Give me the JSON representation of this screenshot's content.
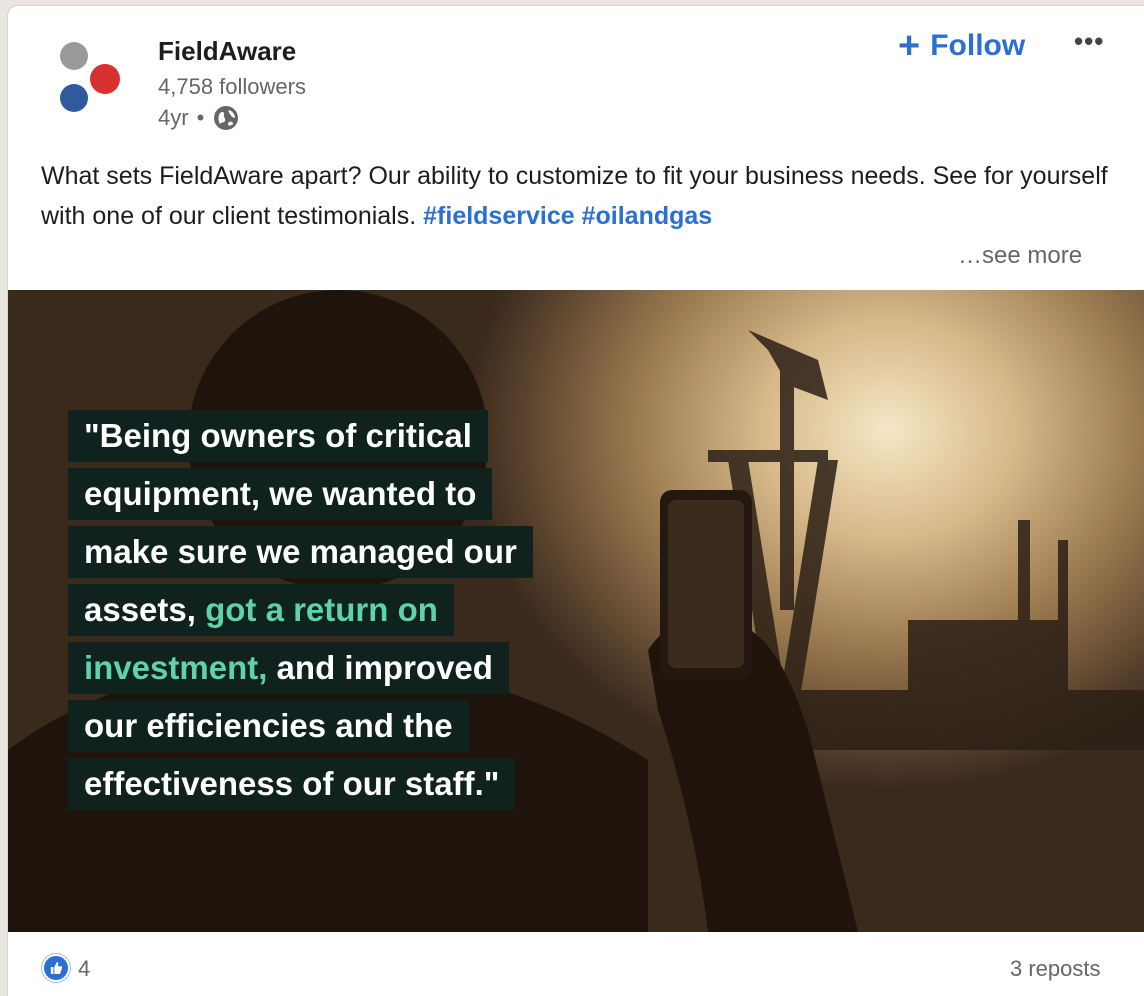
{
  "post": {
    "company": "FieldAware",
    "followers": "4,758 followers",
    "age": "4yr",
    "separator": "•",
    "follow_plus": "+",
    "follow_label": "Follow",
    "more_label": "•••",
    "text_main": "What sets FieldAware apart? Our ability to customize to fit your business needs. See for yourself with one of our client testimonials.",
    "hashtags": [
      "#fieldservice",
      "#oilandgas"
    ],
    "see_more": "…see more"
  },
  "media": {
    "quote_lines": [
      {
        "parts": [
          "\"Being owners of critical",
          "",
          ""
        ]
      },
      {
        "parts": [
          "equipment, we wanted to",
          "",
          ""
        ]
      },
      {
        "parts": [
          "make sure we managed our",
          "",
          ""
        ]
      },
      {
        "parts": [
          "assets, ",
          "got a return on",
          ""
        ]
      },
      {
        "parts": [
          "",
          "investment,",
          " and improved"
        ]
      },
      {
        "parts": [
          "our efficiencies and the",
          "",
          ""
        ]
      },
      {
        "parts": [
          "effectiveness of our staff.\"",
          "",
          ""
        ]
      }
    ]
  },
  "footer": {
    "reaction_count": "4",
    "reposts": "3 reposts"
  },
  "colors": {
    "brand_blue": "#2a6fd1",
    "quote_bg": "#0f221d",
    "quote_accent": "#5fd1ab",
    "logo_grey": "#9a9a9a",
    "logo_red": "#d8322e",
    "logo_blue": "#2f5a9c"
  },
  "icons": {
    "globe": "globe-icon",
    "like": "thumbs-up-icon",
    "more": "ellipsis-icon"
  }
}
